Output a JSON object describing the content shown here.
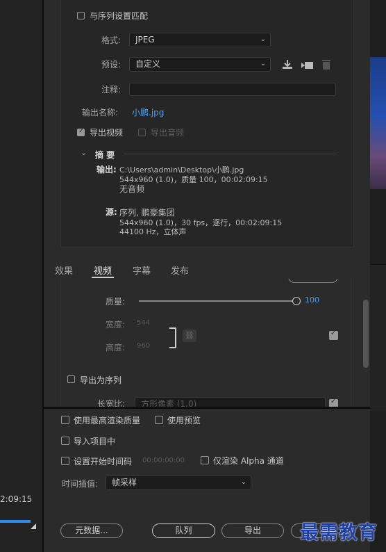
{
  "left": {
    "timecode": "2:09:15"
  },
  "top": {
    "match_sequence": "与序列设置匹配"
  },
  "format": {
    "label": "格式:",
    "value": "JPEG"
  },
  "preset": {
    "label": "预设:",
    "value": "自定义"
  },
  "comment": {
    "label": "注释:",
    "value": ""
  },
  "output_name": {
    "label": "输出名称:",
    "value": "小鹏.jpg"
  },
  "export_video": "导出视频",
  "export_audio": "导出音频",
  "summary": {
    "title": "摘 要",
    "output_label": "输出:",
    "output_lines": [
      "C:\\Users\\admin\\Desktop\\小鹏.jpg",
      "544x960 (1.0)，质量 100，00:02:09:15",
      "无音频"
    ],
    "source_label": "源:",
    "source_lines": [
      "序列, 鹏豪集团",
      "544x960 (1.0)，30 fps，逐行，00:02:09:15",
      "44100 Hz，立体声"
    ]
  },
  "tabs": [
    "效果",
    "视频",
    "字幕",
    "发布"
  ],
  "video": {
    "quality_label": "质量:",
    "quality_value": "100",
    "quality_fraction": 1.0,
    "width_label": "宽度:",
    "width_value": "544",
    "height_label": "高度:",
    "height_value": "960",
    "export_sequence": "导出为序列",
    "aspect_label": "长宽比:",
    "aspect_value": "方形像素 (1.0)"
  },
  "options": {
    "max_render": "使用最高渲染质量",
    "use_preview": "使用预览",
    "import_project": "导入项目中",
    "set_start": "设置开始时间码",
    "start_time": "00:00:00:00",
    "alpha_only": "仅渲染 Alpha 通道",
    "interp_label": "时间插值:",
    "interp_value": "帧采样"
  },
  "buttons": {
    "metadata": "元数据...",
    "queue": "队列",
    "export": "导出"
  },
  "watermark": "最需教育",
  "colors": {
    "accent": "#2d8ceb",
    "link": "#4a9ff0"
  }
}
